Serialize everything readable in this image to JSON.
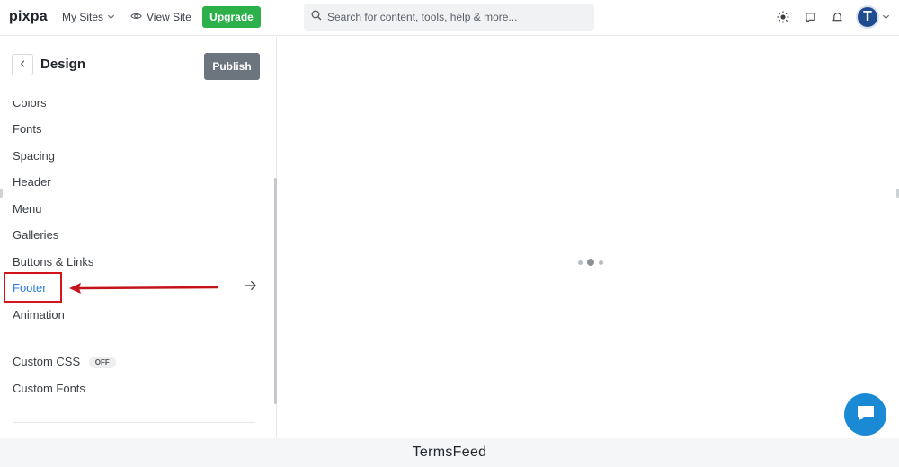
{
  "topbar": {
    "logo": "pixpa",
    "my_sites": "My Sites",
    "view_site": "View Site",
    "upgrade": "Upgrade",
    "search_placeholder": "Search for content, tools, help & more...",
    "avatar_letter": "T"
  },
  "sidebar": {
    "title": "Design",
    "publish": "Publish",
    "items": [
      {
        "label": "Colors"
      },
      {
        "label": "Fonts"
      },
      {
        "label": "Spacing"
      },
      {
        "label": "Header"
      },
      {
        "label": "Menu"
      },
      {
        "label": "Galleries"
      },
      {
        "label": "Buttons & Links"
      },
      {
        "label": "Footer"
      },
      {
        "label": "Animation"
      },
      {
        "label": "Custom CSS"
      },
      {
        "label": "Custom Fonts"
      }
    ],
    "active_item": "Footer",
    "custom_css_toggle": "OFF"
  },
  "caption": "TermsFeed",
  "colors": {
    "accent": "#2b7de0",
    "upgrade": "#2cb14a",
    "publish": "#6c757d",
    "highlight": "#d4141c",
    "chat": "#1a8ad4"
  },
  "icons": [
    "chevron-down-icon",
    "eye-icon",
    "search-icon",
    "sun-icon",
    "chat-bubble-icon",
    "bell-icon",
    "chevron-left-icon",
    "arrow-right-icon",
    "chat-icon"
  ]
}
